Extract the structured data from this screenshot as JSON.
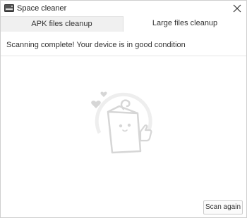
{
  "window": {
    "title": "Space cleaner",
    "app_icon": "hard-drive-icon",
    "close_icon": "close-icon"
  },
  "tabs": [
    {
      "label": "APK files cleanup",
      "active": false
    },
    {
      "label": "Large files cleanup",
      "active": true
    }
  ],
  "status": {
    "message": "Scanning complete! Your device is in good condition"
  },
  "illustration": {
    "icon": "happy-bag-mascot-icon"
  },
  "actions": {
    "scan_again_label": "Scan again"
  },
  "colors": {
    "illustration_gray": "#d6d6d6",
    "border": "#cfcfcf",
    "tab_inactive_bg": "#f0f0f0"
  }
}
